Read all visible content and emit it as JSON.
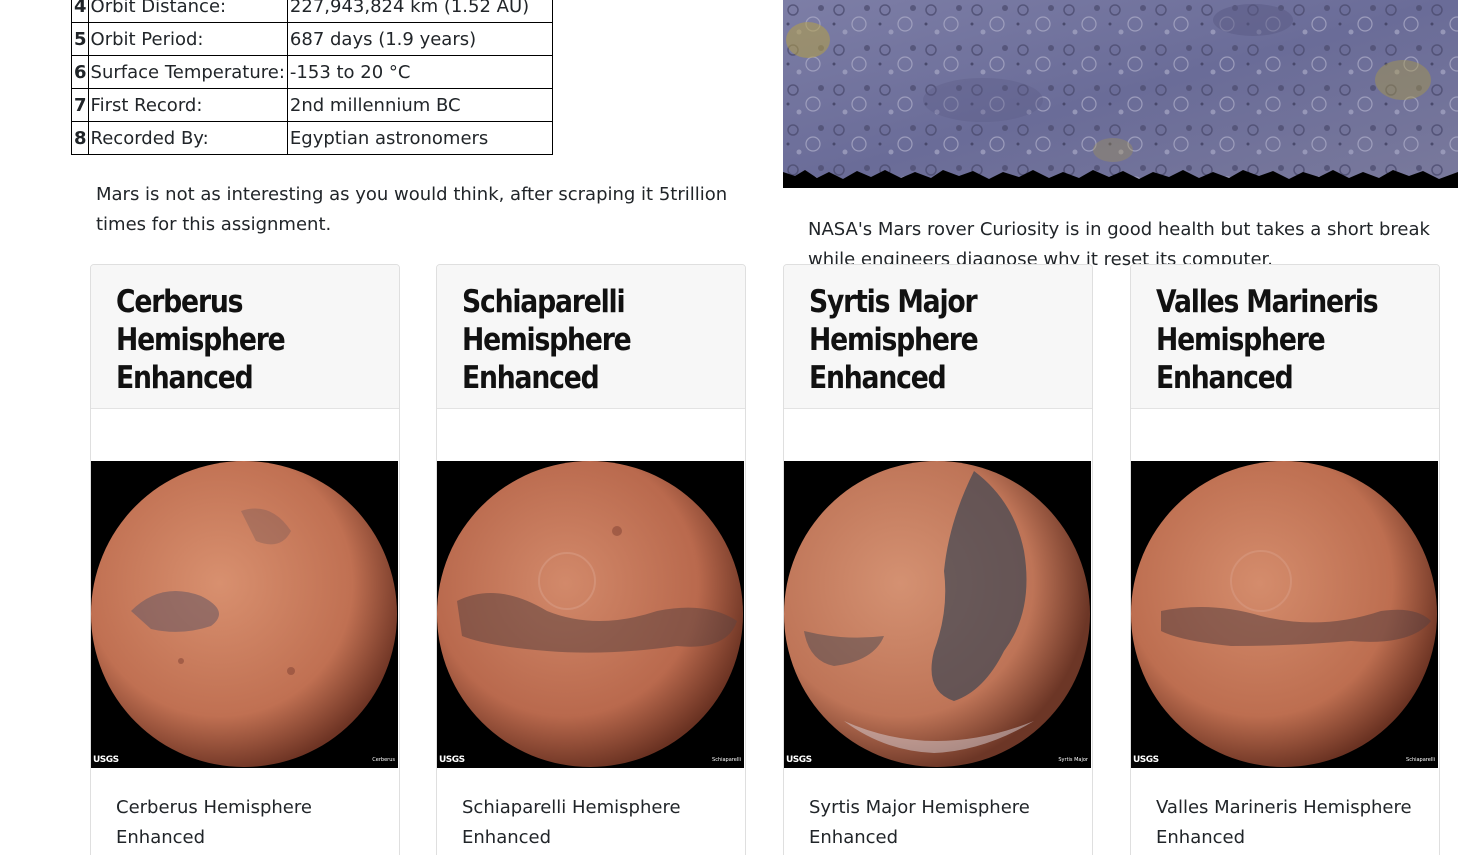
{
  "facts": [
    {
      "index": "4",
      "label": "Orbit Distance:",
      "value": "227,943,824 km (1.52 AU)"
    },
    {
      "index": "5",
      "label": "Orbit Period:",
      "value": "687 days (1.9 years)"
    },
    {
      "index": "6",
      "label": "Surface Temperature:",
      "value": "-153 to 20 °C"
    },
    {
      "index": "7",
      "label": "First Record:",
      "value": "2nd millennium BC"
    },
    {
      "index": "8",
      "label": "Recorded By:",
      "value": "Egyptian astronomers"
    }
  ],
  "left_paragraph": "Mars is not as interesting as you would think, after scraping it 5trillion times for this assignment.",
  "news_paragraph": "NASA's Mars rover Curiosity is in good health but takes a short break while engineers diagnose why it reset its computer.",
  "hemispheres": [
    {
      "title": "Cerberus Hemisphere Enhanced",
      "text": "Cerberus Hemisphere Enhanced",
      "logo": "USGS",
      "caption": "Cerberus",
      "colors": {
        "planet": "#c8775a",
        "dark": "#6e5a62"
      }
    },
    {
      "title": "Schiaparelli Hemisphere Enhanced",
      "text": "Schiaparelli Hemisphere Enhanced",
      "logo": "USGS",
      "caption": "Schiaparelli",
      "colors": {
        "planet": "#c27355",
        "dark": "#5e4440"
      }
    },
    {
      "title": "Syrtis Major Hemisphere Enhanced",
      "text": "Syrtis Major Hemisphere Enhanced",
      "logo": "USGS",
      "caption": "Syrtis Major",
      "colors": {
        "planet": "#c47a5a",
        "dark": "#3e4652"
      }
    },
    {
      "title": "Valles Marineris Hemisphere Enhanced",
      "text": "Valles Marineris Hemisphere Enhanced",
      "logo": "USGS",
      "caption": "Schiaparelli",
      "colors": {
        "planet": "#c4765a",
        "dark": "#5a4040"
      }
    }
  ],
  "colors": {
    "card_header_bg": "#f7f7f7",
    "card_border": "#dfdfdf",
    "text": "#212529"
  }
}
